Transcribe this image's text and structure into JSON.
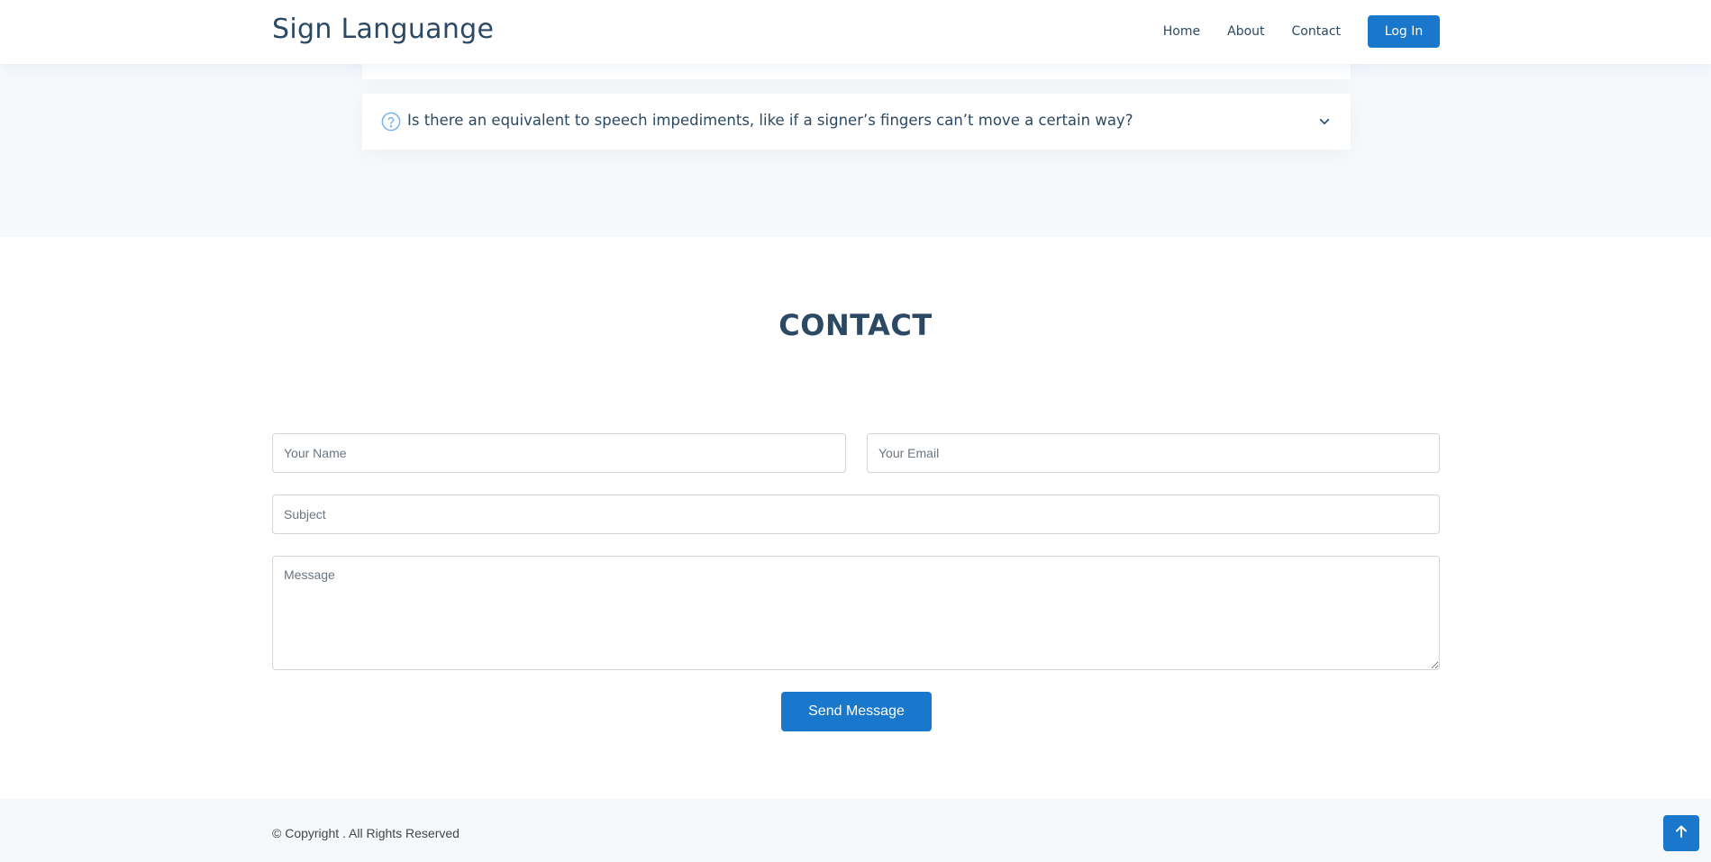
{
  "header": {
    "logo": "Sign Languange",
    "nav": [
      "Home",
      "About",
      "Contact"
    ],
    "login_label": "Log In"
  },
  "faq": {
    "question": "Is there an equivalent to speech impediments, like if a signer’s fingers can’t move a certain way?",
    "icons": [
      "help-circle-icon",
      "chevron-down-icon"
    ]
  },
  "contact": {
    "title": "CONTACT",
    "name_placeholder": "Your Name",
    "email_placeholder": "Your Email",
    "subject_placeholder": "Subject",
    "message_placeholder": "Message",
    "send_label": "Send Message"
  },
  "footer": {
    "copyright": "© Copyright . All Rights Reserved",
    "back_to_top_icon": "arrow-up-icon"
  },
  "colors": {
    "accent": "#1977cc",
    "heading": "#2c4964",
    "section_bg": "#f6f9fc",
    "faq_icon": "#76b5ee"
  }
}
